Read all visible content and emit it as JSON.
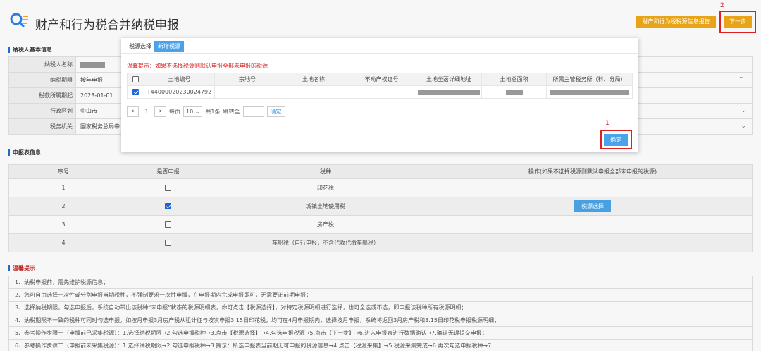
{
  "header": {
    "title": "财产和行为税合并纳税申报",
    "report_button": "财产和行为税税源信息报告",
    "next_button": "下一步",
    "annotation_2": "2"
  },
  "taxpayer": {
    "section_title": "纳税人基本信息",
    "rows": [
      {
        "label": "纳税人名称",
        "value": ""
      },
      {
        "label": "纳税期限",
        "value": "按年申报"
      },
      {
        "label": "税款所属期起",
        "value": "2023-01-01"
      },
      {
        "label": "行政区划",
        "value": "中山市"
      },
      {
        "label": "税务机关",
        "value": "国家税务总局中"
      }
    ]
  },
  "declaration": {
    "section_title": "申报表信息",
    "headers": [
      "序号",
      "是否申报",
      "税种",
      "操作(如果不选择税源则默认申报全部未申报的税源)"
    ],
    "rows": [
      {
        "no": "1",
        "checked": false,
        "tax": "印花税",
        "action": ""
      },
      {
        "no": "2",
        "checked": true,
        "tax": "城镇土地使用税",
        "action": "税源选择"
      },
      {
        "no": "3",
        "checked": false,
        "tax": "房产税",
        "action": ""
      },
      {
        "no": "4",
        "checked": false,
        "tax": "车船税（自行申报，不含代收代缴车船税）",
        "action": ""
      }
    ]
  },
  "tips": {
    "section_title": "温馨提示",
    "lines": [
      "1、纳税申报前，需先维护税源信息；",
      "2、您可自由选择一次性或分别申报当期税种，不强制要求一次性申报，在申报期内完成申报即可，无需要正前期申报；",
      "3、选择纳税期限，勾选申报后，系统自动带出该税种“未申报”状态的税源明细表，你可点击【税源选择】，对特定税源明细进行选择，也可全选或不选，即申报该税种所有税源明细；",
      "4、纳税期限不一致的税种可同时勾选申报。如按月申报3月房产税从租计征与按次申报3.15日印花税，均可在4月申报期内，选择按月申报，系统将返回3月房产税和3.15日印花税申报税源明细；",
      "5、参考操作步骤一（申报前已采集税源）：1.选择纳税期限→2.勾选申报税种→3.点击【税源选择】→4.勾选申报税源→5.点击【下一步】→6.进入申报表进行数据确认→7.确认无误提交申报；",
      "6、参考操作步骤二（申报前未采集税源）：1.选择纳税期限→2.勾选申报税种→3.提示：所选申报表当前期无可申报的税源信息→4.点击【税源采集】→5.税源采集完成→6.再次勾选申报税种→7."
    ]
  },
  "modal": {
    "tab_selected_label": "税源选择",
    "tab_new_label": "新增税源",
    "warning": "温馨提示：如果不选择税源则默认申报全部未申报的税源",
    "headers": [
      "",
      "土地编号",
      "宗地号",
      "土地名称",
      "不动产权证号",
      "土地坐落详细地址",
      "土地总面积",
      "所属主管税务所（科、分局）"
    ],
    "row": {
      "checked": true,
      "land_no": "T44000020230024792"
    },
    "pager": {
      "page": "1",
      "per_page_label": "每页",
      "per_page": "10",
      "total": "共1条",
      "goto": "跳转至",
      "ok": "确定"
    },
    "confirm_button": "确定",
    "annotation_1": "1"
  },
  "colors": {
    "accent_blue": "#4aa3ea",
    "orange": "#e8a416",
    "warning_red": "#d81e1e"
  }
}
